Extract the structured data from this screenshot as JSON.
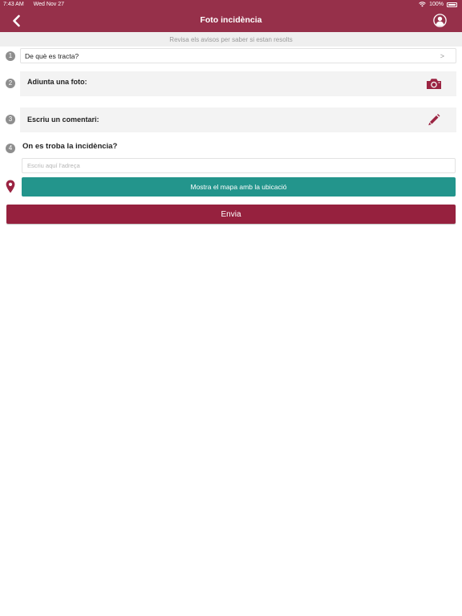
{
  "status_bar": {
    "time": "7:43 AM",
    "date": "Wed Nov 27",
    "battery": "100%",
    "icons": [
      "wifi-icon",
      "battery-icon"
    ]
  },
  "header": {
    "title": "Foto incidència",
    "icons": [
      "chevron-left-icon",
      "user-icon"
    ]
  },
  "notice": "Revisa els avisos per saber si estan resolts",
  "steps": {
    "s1": "1",
    "s2": "2",
    "s3": "3",
    "s4": "4"
  },
  "category": {
    "label": "De què es tracta?",
    "chevron": ">"
  },
  "photo": {
    "label": "Adjunta una foto:",
    "icon": "camera-icon"
  },
  "comment": {
    "label": "Escriu un comentari:",
    "icon": "pencil-icon"
  },
  "location": {
    "heading": "On es troba la incidència?",
    "placeholder": "Escriu aquí l'adreça",
    "value": "",
    "map_button": "Mostra el mapa amb la ubicació",
    "icon": "map-pin-icon"
  },
  "send_button": "Envia",
  "colors": {
    "brand": "#96304a",
    "send": "#96213e",
    "teal": "#23958c",
    "icon": "#9b2442"
  }
}
